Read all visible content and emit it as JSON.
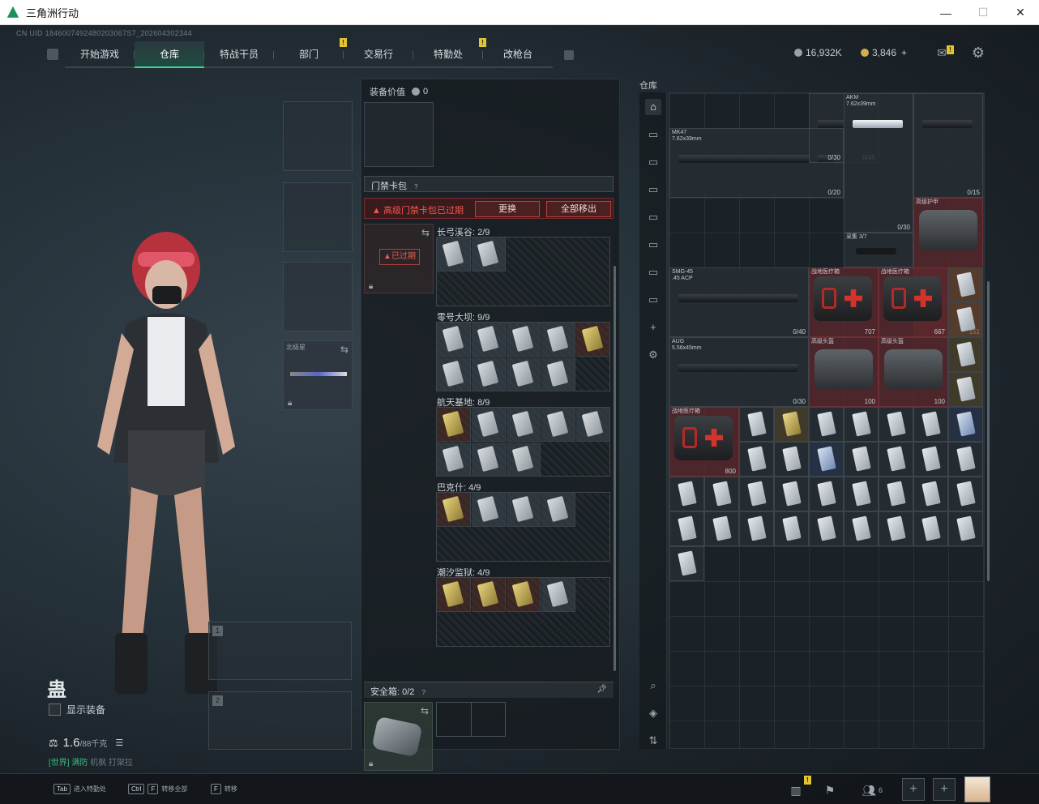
{
  "window": {
    "title": "三角洲行动",
    "minimize": "—",
    "maximize": "☐",
    "close": "✕"
  },
  "uid": "CN UID 1846007492480203067S7_202604302344",
  "nav": {
    "tabs": [
      {
        "label": "开始游戏",
        "active": false,
        "badge": ""
      },
      {
        "label": "仓库",
        "active": true,
        "badge": ""
      },
      {
        "label": "特战干员",
        "active": false,
        "badge": ""
      },
      {
        "label": "部门",
        "active": false,
        "badge": "!"
      },
      {
        "label": "交易行",
        "active": false,
        "badge": ""
      },
      {
        "label": "特勤处",
        "active": false,
        "badge": "!"
      },
      {
        "label": "改枪台",
        "active": false,
        "badge": ""
      }
    ]
  },
  "currency": {
    "silver": "16,932K",
    "gold": "3,846",
    "gold_plus": "+",
    "mail_badge": "!"
  },
  "character": {
    "name": "蛊",
    "show_equipment_label": "显示装备",
    "weight_value": "1.6",
    "weight_max": "/88千克",
    "status_green": "[世界] 满防",
    "status_rest": "机枫 打架拉",
    "melee_slot_label": "北极星",
    "weapon_slot_1": "1",
    "weapon_slot_2": "2"
  },
  "middle": {
    "equip_value_label": "装备价值",
    "equip_value": "0",
    "keycard_section": "门禁卡包",
    "warning": "高级门禁卡包已过期",
    "replace_btn": "更换",
    "remove_all_btn": "全部移出",
    "expired_label": "已过期",
    "maps": [
      {
        "name": "长弓溪谷: 2/9",
        "cards": [
          "silver",
          "silver"
        ]
      },
      {
        "name": "零号大坝: 9/9",
        "cards": [
          "silver",
          "silver",
          "silver",
          "silver",
          "gold",
          "silver",
          "silver",
          "silver",
          "silver"
        ]
      },
      {
        "name": "航天基地: 8/9",
        "cards": [
          "gold",
          "silver",
          "silver",
          "silver",
          "silver",
          "silver",
          "silver",
          "silver"
        ]
      },
      {
        "name": "巴克什: 4/9",
        "cards": [
          "gold",
          "silver",
          "silver",
          "silver"
        ]
      },
      {
        "name": "潮汐监狱: 4/9",
        "cards": [
          "gold",
          "gold",
          "gold",
          "silver"
        ]
      }
    ],
    "safe_box_label": "安全箱:",
    "safe_box_count": "0/2"
  },
  "stash": {
    "title": "仓库",
    "items": [
      {
        "name": "MK47\n7.62x39mm",
        "count": "0/20",
        "kind": "gun"
      },
      {
        "name": "",
        "count": "0/45",
        "kind": "gun"
      },
      {
        "name": "AKM\n7.62x39mm",
        "count": "0/30",
        "kind": "gun-white"
      },
      {
        "name": "",
        "count": "0/30",
        "kind": "gun"
      },
      {
        "name": "",
        "count": "0/15",
        "kind": "gun"
      },
      {
        "name": "高级护甲",
        "count": "151",
        "kind": "armor"
      },
      {
        "name": "采集 3/7",
        "count": "",
        "kind": "scope"
      },
      {
        "name": "SMG-45\n.45 ACP",
        "count": "0/40",
        "kind": "gun"
      },
      {
        "name": "战地医疗箱",
        "count": "707",
        "kind": "medkit"
      },
      {
        "name": "战地医疗箱",
        "count": "667",
        "kind": "medkit"
      },
      {
        "name": "AUG\n5.56x45mm",
        "count": "0/30",
        "kind": "gun"
      },
      {
        "name": "高级头盔",
        "count": "100",
        "kind": "armor"
      },
      {
        "name": "高级头盔",
        "count": "100",
        "kind": "armor"
      },
      {
        "name": "战地医疗箱",
        "count": "800",
        "kind": "medkit"
      }
    ],
    "cards_grid": [
      "silver",
      "gold",
      "silver",
      "silver",
      "silver",
      "silver",
      "blue",
      "silver",
      "silver",
      "blue",
      "silver",
      "silver",
      "silver",
      "silver",
      "silver",
      "silver",
      "silver",
      "silver",
      "silver",
      "silver",
      "silver",
      "silver",
      "silver",
      "silver",
      "silver",
      "silver",
      "silver",
      "silver",
      "silver",
      "silver",
      "silver",
      "silver",
      "silver",
      "silver",
      "silver",
      "silver"
    ]
  },
  "bottom": {
    "hint1_key": "Tab",
    "hint1": "进入特勤处",
    "hint2_key1": "Ctrl",
    "hint2_key2": "F",
    "hint2": "转移全部",
    "hint3_key": "F",
    "hint3": "转移",
    "friends_count": "6",
    "stats_badge": "!"
  }
}
